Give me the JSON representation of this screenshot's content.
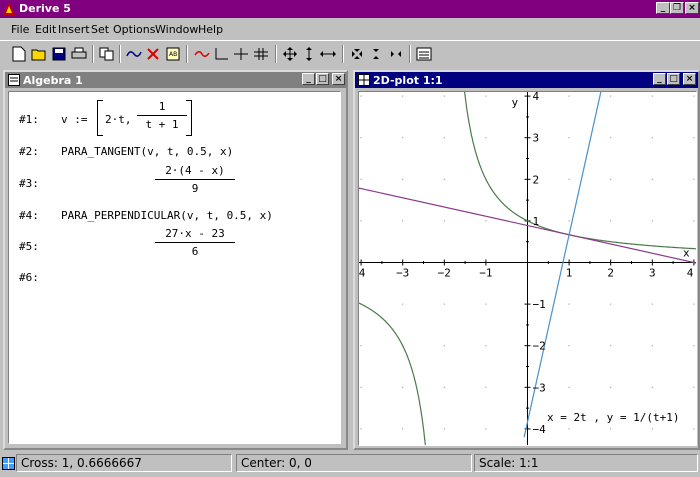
{
  "app": {
    "title": "Derive 5"
  },
  "menu": [
    "File",
    "Edit",
    "Insert",
    "Set",
    "Options",
    "Window",
    "Help"
  ],
  "toolbar_icons": [
    "new-file-icon",
    "open-file-icon",
    "save-icon",
    "print-icon",
    "copy-icon",
    "simplify-icon",
    "delete-icon",
    "author-icon",
    "plot-line-icon",
    "axes-icon",
    "crosshair-icon",
    "grid-cross-icon",
    "move-icon",
    "scale-vertical-icon",
    "scale-horizontal-icon",
    "zoom-in-icon",
    "zoom-vertical-icon",
    "zoom-horizontal-icon",
    "plot-window-icon"
  ],
  "algebra": {
    "title": "Algebra 1",
    "exprs": {
      "e1": {
        "label": "#1:",
        "lhs": "v :=",
        "v1": "2·t,",
        "num": "1",
        "den": "t + 1"
      },
      "e2": {
        "label": "#2:",
        "text": "PARA_TANGENT(v, t, 0.5, x)"
      },
      "e3": {
        "label": "#3:",
        "num": "2·(4 - x)",
        "den": "9"
      },
      "e4": {
        "label": "#4:",
        "text": "PARA_PERPENDICULAR(v, t, 0.5, x)"
      },
      "e5": {
        "label": "#5:",
        "num": "27·x - 23",
        "den": "6"
      },
      "e6": {
        "label": "#6:"
      }
    }
  },
  "plot": {
    "title": "2D-plot 1:1",
    "xlabel": "x",
    "ylabel": "y",
    "annotation": "x = 2t , y = 1/(t+1)",
    "xtick_labels": [
      "4",
      "−3",
      "−2",
      "−1",
      "1",
      "2",
      "3",
      "4"
    ],
    "ytick_labels": [
      "4",
      "3",
      "2",
      "1",
      "−1",
      "−2",
      "−3",
      "−4"
    ],
    "colors": {
      "hyperbola": "#4a7a4a",
      "tangent": "#8a3a8a",
      "perpendicular": "#4a90c8"
    }
  },
  "chart_data": {
    "type": "line",
    "xlim": [
      -4,
      4
    ],
    "ylim": [
      -4,
      4
    ],
    "grid": "dots",
    "series": [
      {
        "expr": "x = 2t, y = 1/(t+1)"
      },
      {
        "expr": "2·(4 - x)/9"
      },
      {
        "expr": "(27·x - 23)/6"
      }
    ]
  },
  "status": {
    "cross": "Cross: 1, 0.6666667",
    "center": "Center: 0, 0",
    "scale": "Scale: 1:1"
  }
}
